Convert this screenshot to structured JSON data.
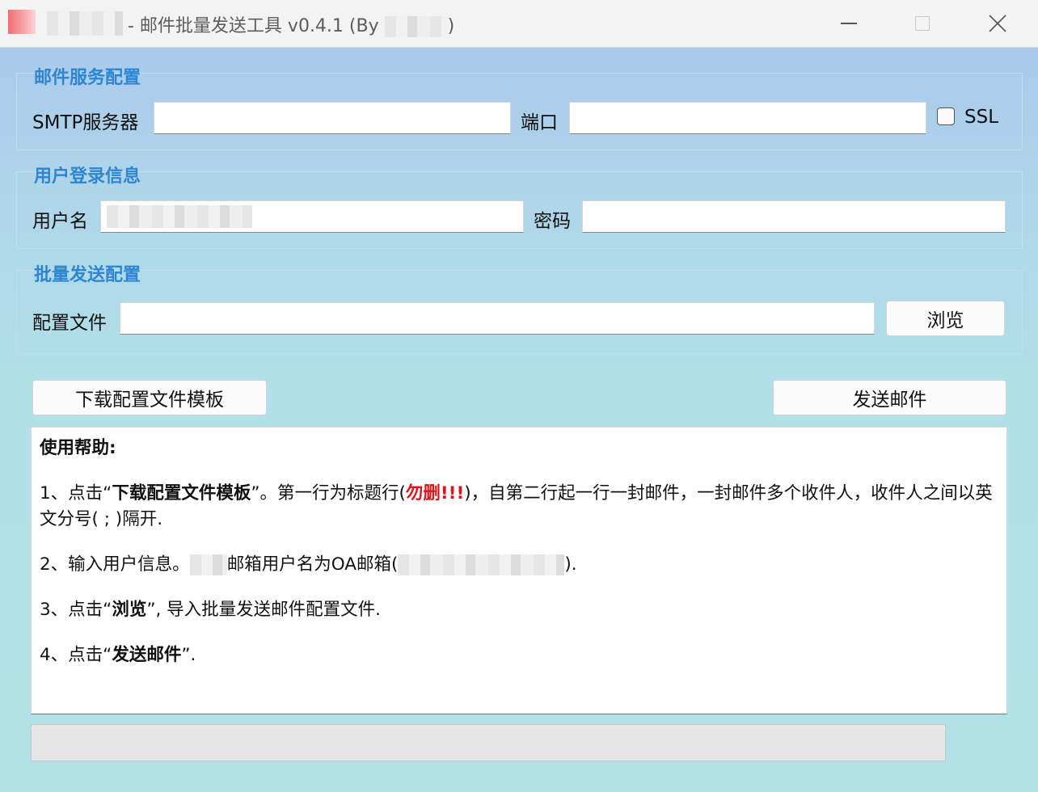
{
  "window": {
    "title": "- 邮件批量发送工具 v0.4.1 (By",
    "title_suffix": ")"
  },
  "smtp_group": {
    "title": "邮件服务配置",
    "server_label": "SMTP服务器",
    "server_value": "",
    "port_label": "端口",
    "port_value": "",
    "ssl_label": "SSL",
    "ssl_checked": false
  },
  "login_group": {
    "title": "用户登录信息",
    "username_label": "用户名",
    "username_value": "",
    "password_label": "密码",
    "password_value": ""
  },
  "batch_group": {
    "title": "批量发送配置",
    "config_label": "配置文件",
    "config_value": "",
    "browse_label": "浏览"
  },
  "actions": {
    "download_template_label": "下载配置文件模板",
    "send_label": "发送邮件"
  },
  "help": {
    "heading": "使用帮助:",
    "step1": {
      "prefix": "1、点击“",
      "bold": "下载配置文件模板",
      "middle": "”。第一行为标题行(",
      "warning": "勿删!!!",
      "suffix": ")，自第二行起一行一封邮件，一封邮件多个收件人，收件人之间以英文分号( ; )隔开."
    },
    "step2": {
      "prefix": "2、输入用户信息。",
      "middle": "邮箱用户名为OA邮箱(",
      "suffix": ")."
    },
    "step3": {
      "prefix": "3、点击“",
      "bold": "浏览",
      "suffix": "”, 导入批量发送邮件配置文件."
    },
    "step4": {
      "prefix": "4、点击“",
      "bold": "发送邮件",
      "suffix": "”."
    }
  },
  "progress": {
    "value": 0
  },
  "colors": {
    "group_title": "#2e86d0",
    "warning": "#e0121a"
  }
}
